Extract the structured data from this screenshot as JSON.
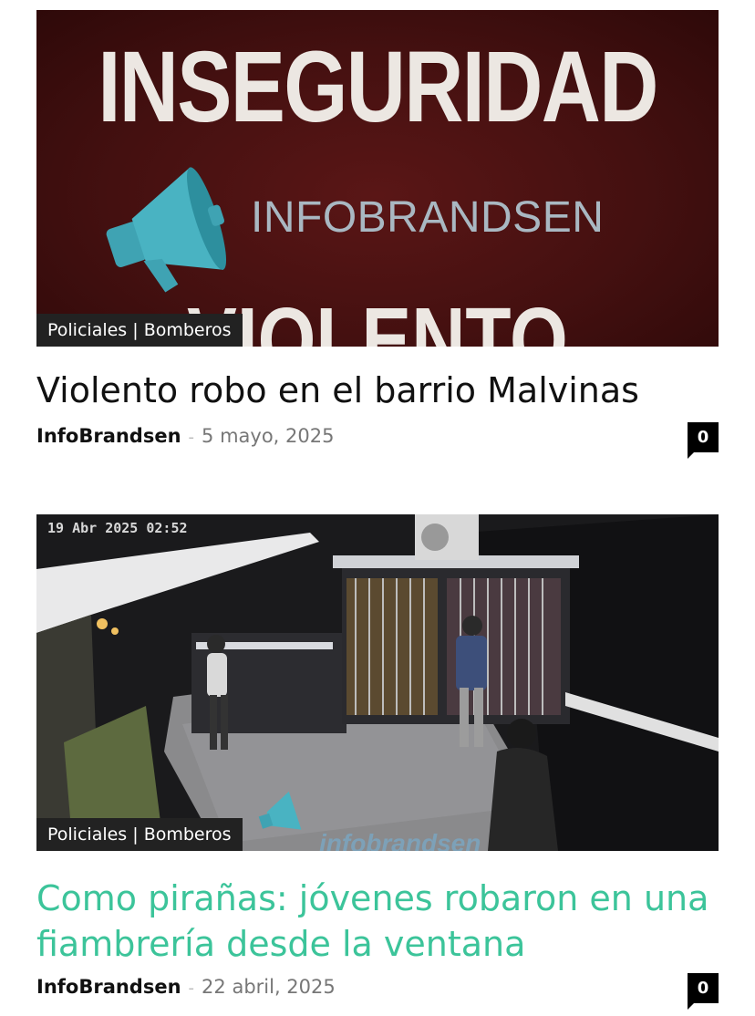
{
  "articles": [
    {
      "image": {
        "headline": "INSEGURIDAD",
        "brand": "INFOBRANDSEN",
        "sub": "VIOLENTO ROBO",
        "bg_color": "#4a1212",
        "icon": "megaphone-icon"
      },
      "category": [
        "Policiales",
        "Bomberos"
      ],
      "title": "Violento robo en el barrio Malvinas",
      "author": "InfoBrandsen",
      "separator": "-",
      "date": "5 mayo, 2025",
      "comments": "0"
    },
    {
      "image": {
        "timestamp": "19 Abr 2025 02:52",
        "watermark": "infobrandsen"
      },
      "category": [
        "Policiales",
        "Bomberos"
      ],
      "title": "Como pirañas: jóvenes robaron en una fiambrería desde la ventana",
      "title_color": "#3cc49a",
      "author": "InfoBrandsen",
      "separator": "-",
      "date": "22 abril, 2025",
      "comments": "0"
    }
  ]
}
